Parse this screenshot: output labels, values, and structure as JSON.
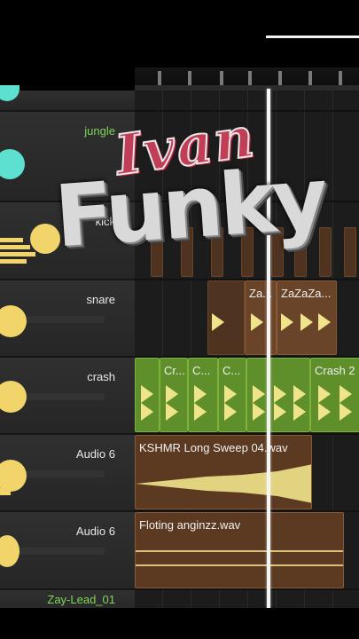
{
  "tracks": [
    {
      "name": "jungle",
      "name_color": "green"
    },
    {
      "name": "kick"
    },
    {
      "name": "snare"
    },
    {
      "name": "crash"
    },
    {
      "name": "Audio 6"
    },
    {
      "name": "Audio 6"
    },
    {
      "name": "Zay-Lead_01",
      "name_color": "green"
    }
  ],
  "clips": {
    "snare": [
      "Za...",
      "ZaZaZa..."
    ],
    "crash": [
      "Cr...",
      "C...",
      "C...",
      "Crash 2"
    ],
    "audio6_a": "KSHMR Long Sweep 04.wav",
    "audio6_b": "Floting anginzz.wav"
  },
  "watermark": {
    "line1": "Ivan",
    "line2": "Funky"
  },
  "colors": {
    "clip_brown": "#6a4428",
    "clip_green": "#5f8f2a",
    "knob_yellow": "#f2d56a",
    "knob_cyan": "#5ee0d0",
    "name_green": "#7fd65a"
  }
}
